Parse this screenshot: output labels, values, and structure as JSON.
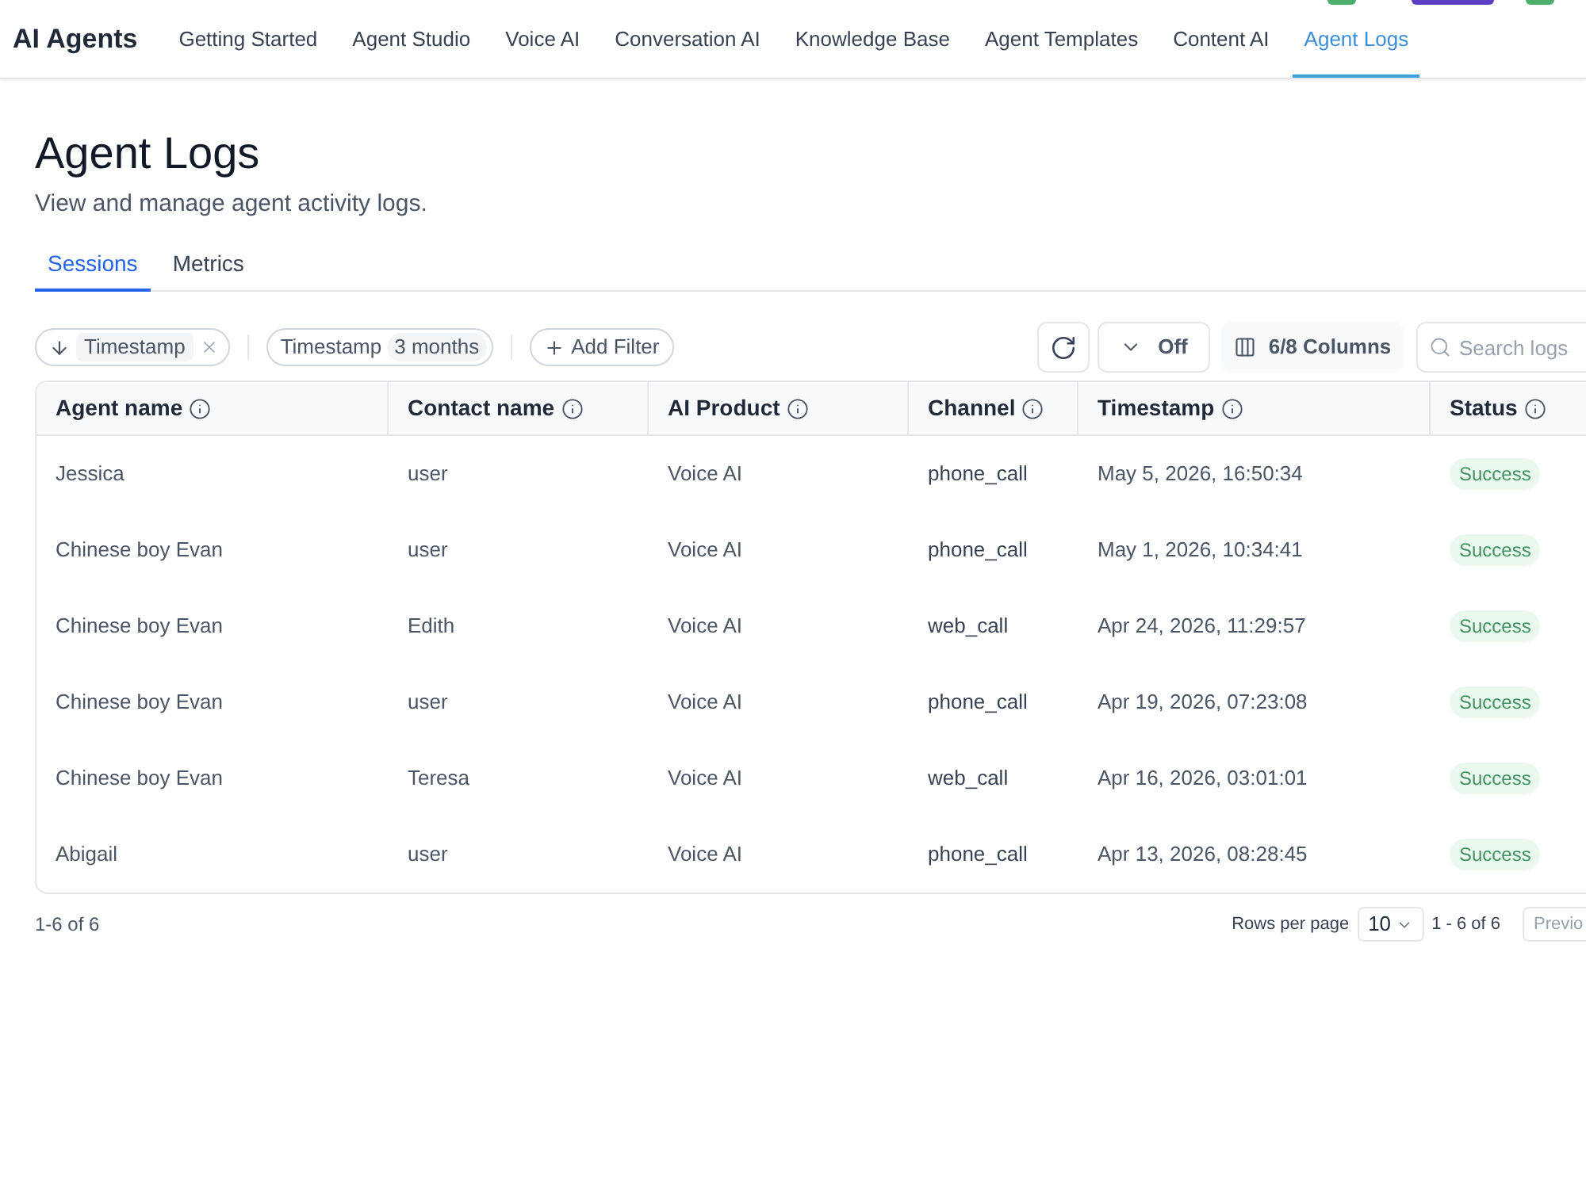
{
  "app": {
    "title": "AI Agents"
  },
  "nav": [
    {
      "label": "Getting Started",
      "selected": false
    },
    {
      "label": "Agent Studio",
      "selected": false
    },
    {
      "label": "Voice AI",
      "selected": false
    },
    {
      "label": "Conversation AI",
      "selected": false
    },
    {
      "label": "Knowledge Base",
      "selected": false
    },
    {
      "label": "Agent Templates",
      "selected": false
    },
    {
      "label": "Content AI",
      "selected": false
    },
    {
      "label": "Agent Logs",
      "selected": true
    }
  ],
  "page": {
    "title": "Agent Logs",
    "subtitle": "View and manage agent activity logs."
  },
  "tabs": [
    {
      "label": "Sessions",
      "selected": true
    },
    {
      "label": "Metrics",
      "selected": false
    }
  ],
  "filters": [
    {
      "kind": "sort",
      "label": "Timestamp"
    },
    {
      "kind": "range",
      "label": "Timestamp",
      "value": "3 months"
    },
    {
      "kind": "add",
      "label": "Add Filter"
    }
  ],
  "toolbar": {
    "auto_refresh": "Off",
    "columns": "6/8 Columns",
    "search": {
      "placeholder": "Search logs"
    }
  },
  "table": {
    "columns": [
      "Agent name",
      "Contact name",
      "AI Product",
      "Channel",
      "Timestamp",
      "Status"
    ],
    "rows": [
      {
        "agent": "Jessica",
        "contact": "user",
        "product": "Voice AI",
        "channel": "phone_call",
        "timestamp": "May 5, 2026, 16:50:34",
        "status": "Success"
      },
      {
        "agent": "Chinese boy Evan",
        "contact": "user",
        "product": "Voice AI",
        "channel": "phone_call",
        "timestamp": "May 1, 2026, 10:34:41",
        "status": "Success"
      },
      {
        "agent": "Chinese boy Evan",
        "contact": "Edith",
        "product": "Voice AI",
        "channel": "web_call",
        "timestamp": "Apr 24, 2026, 11:29:57",
        "status": "Success"
      },
      {
        "agent": "Chinese boy Evan",
        "contact": "user",
        "product": "Voice AI",
        "channel": "phone_call",
        "timestamp": "Apr 19, 2026, 07:23:08",
        "status": "Success"
      },
      {
        "agent": "Chinese boy Evan",
        "contact": "Teresa",
        "product": "Voice AI",
        "channel": "web_call",
        "timestamp": "Apr 16, 2026, 03:01:01",
        "status": "Success"
      },
      {
        "agent": "Abigail",
        "contact": "user",
        "product": "Voice AI",
        "channel": "phone_call",
        "timestamp": "Apr 13, 2026, 08:28:45",
        "status": "Success"
      }
    ]
  },
  "footer": {
    "count": "1-6 of 6",
    "rows_per_page_label": "Rows per page",
    "rows_per_page": "10",
    "range": "1 - 6 of 6",
    "previous": {
      "label": "Previo",
      "disabled": true
    }
  }
}
